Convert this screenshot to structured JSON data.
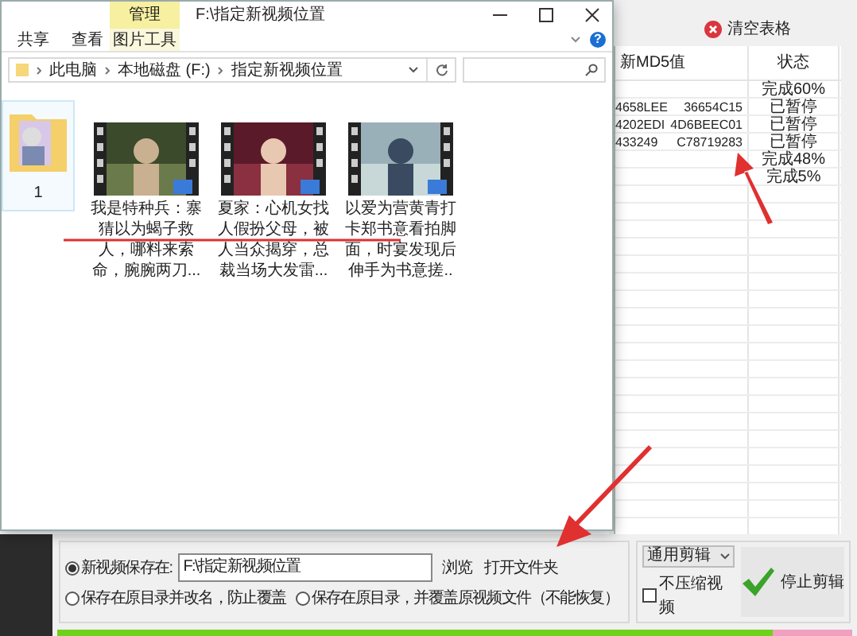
{
  "app": {
    "clear_button": "清空表格",
    "table": {
      "columns": [
        "新MD5值",
        "状态"
      ],
      "rows": [
        {
          "md5_start": "",
          "md5_end": "",
          "status": "完成60%"
        },
        {
          "md5_start": "4658LEE",
          "md5_end": "36654C15",
          "status": "已暂停"
        },
        {
          "md5_start": "4202EDI",
          "md5_end": "4D6BEEC01",
          "status": "已暂停"
        },
        {
          "md5_start": "433249",
          "md5_end": "C78719283",
          "status": "已暂停"
        },
        {
          "md5_start": "",
          "md5_end": "",
          "status": "完成48%"
        },
        {
          "md5_start": "",
          "md5_end": "",
          "status": "完成5%"
        }
      ]
    },
    "output": {
      "options": [
        {
          "label": "新视频保存在:",
          "selected": true,
          "path": "F:\\指定新视频位置",
          "browse": "浏览",
          "open_folder": "打开文件夹"
        },
        {
          "label": "保存在原目录并改名，防止覆盖",
          "selected": false
        },
        {
          "label": "保存在原目录，并覆盖原视频文件（不能恢复）",
          "selected": false
        }
      ],
      "mode": "通用剪辑",
      "compress": {
        "label": "不压缩视频",
        "checked": false
      },
      "stop_button": "停止剪辑"
    },
    "progress": {
      "level": 0.9
    }
  },
  "explorer": {
    "context_tab": "管理",
    "title": "F:\\指定新视频位置",
    "ribbon_tabs": [
      {
        "label": "共享",
        "selected": false
      },
      {
        "label": "查看",
        "selected": false
      },
      {
        "label": "图片工具",
        "selected": true
      }
    ],
    "help": "?",
    "breadcrumb": [
      "此电脑",
      "本地磁盘 (F:)",
      "指定新视频位置"
    ],
    "items": [
      {
        "kind": "folder",
        "name": "1"
      },
      {
        "kind": "video",
        "name": "我是特种兵：寨猜以为蝎子救人，哪料来索命，腕腕两刀..."
      },
      {
        "kind": "video",
        "name": "夏家：心机女找人假扮父母，被人当众揭穿，总裁当场大发雷..."
      },
      {
        "kind": "video",
        "name": "以爱为营黄青打卡郑书意看拍脚面，时宴发现后伸手为书意搓.."
      }
    ]
  }
}
